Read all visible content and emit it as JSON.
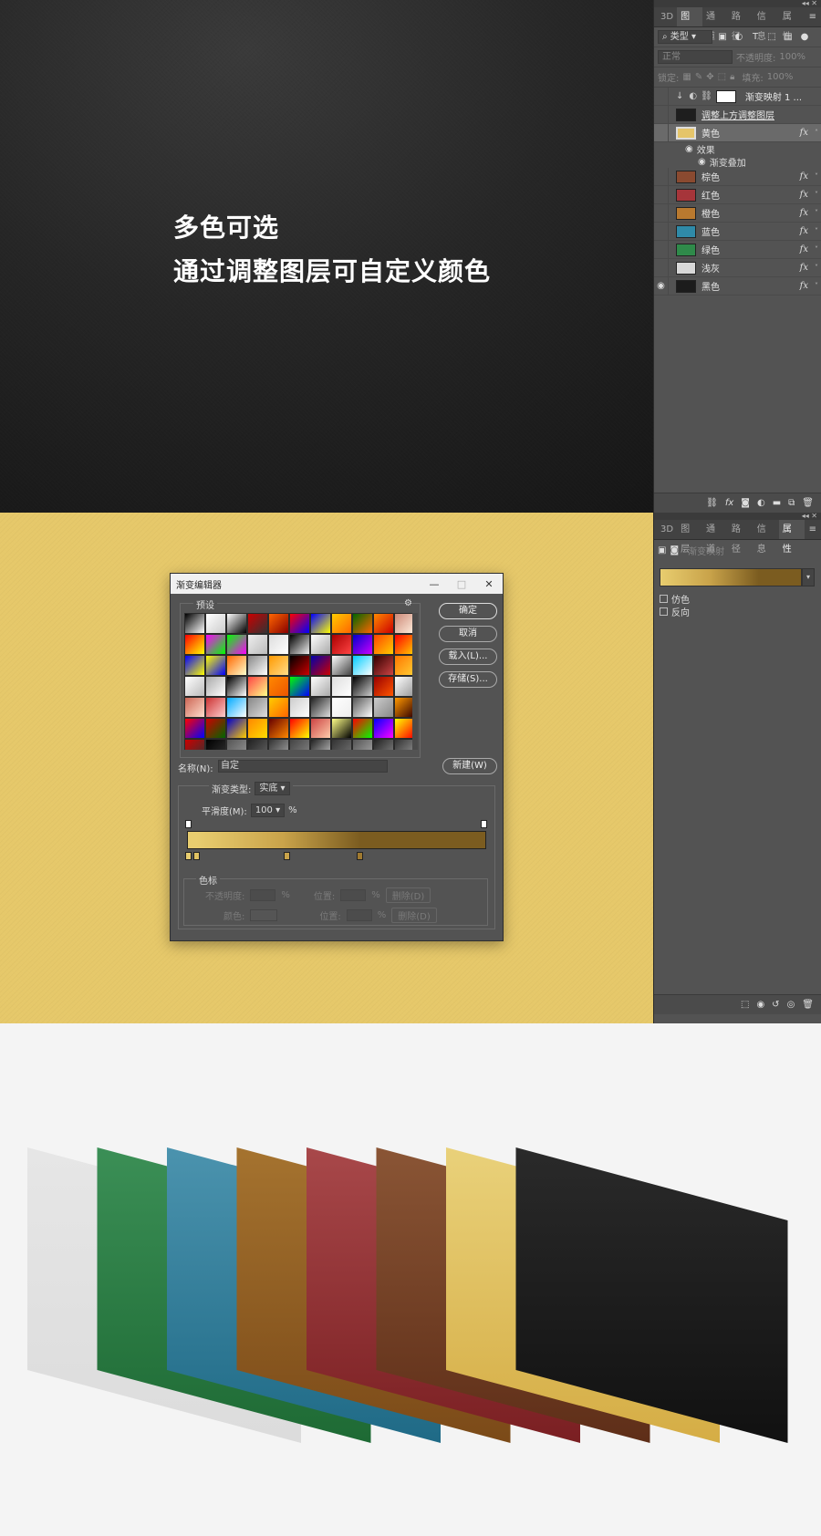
{
  "section1": {
    "headline_line1": "多色可选",
    "headline_line2": "通过调整图层可自定义颜色",
    "panel": {
      "tabs": [
        "3D",
        "图层",
        "通道",
        "路径",
        "信息",
        "属性"
      ],
      "active_tab": "图层",
      "filter_label": "类型",
      "blend_mode": "正常",
      "opacity_label": "不透明度:",
      "opacity_value": "100%",
      "lock_label": "锁定:",
      "fill_label": "填充:",
      "fill_value": "100%",
      "adjustment_layer": "渐变映射 1 ...",
      "adjust_above_layer": "调整上方调整图层",
      "selected_layer": "黄色",
      "effects_label": "效果",
      "gradient_overlay_label": "渐变叠加",
      "layers": [
        {
          "name": "棕色",
          "color": "#8a4a30",
          "fx": "fx"
        },
        {
          "name": "红色",
          "color": "#a6353a",
          "fx": "fx"
        },
        {
          "name": "橙色",
          "color": "#b9792f",
          "fx": "fx"
        },
        {
          "name": "蓝色",
          "color": "#2f8aa8",
          "fx": "fx"
        },
        {
          "name": "绿色",
          "color": "#2f8a4a",
          "fx": "fx"
        },
        {
          "name": "浅灰",
          "color": "#d8d8d8",
          "fx": "fx"
        },
        {
          "name": "黑色",
          "color": "#1c1c1c",
          "fx": "fx"
        }
      ],
      "selected_fx": "fx"
    }
  },
  "section2": {
    "dialog": {
      "title": "渐变编辑器",
      "presets_label": "预设",
      "ok": "确定",
      "cancel": "取消",
      "load": "载入(L)...",
      "save": "存储(S)...",
      "name_label": "名称(N):",
      "name_value": "自定",
      "new_button": "新建(W)",
      "gradient_type_label": "渐变类型:",
      "gradient_type_value": "实底",
      "smoothness_label": "平滑度(M):",
      "smoothness_value": "100",
      "percent": "%",
      "color_stops_label": "色标",
      "opacity_label": "不透明度:",
      "color_label": "颜色:",
      "position_label": "位置:",
      "delete_label": "删除(D)"
    },
    "panel": {
      "tabs": [
        "3D",
        "图层",
        "通道",
        "路径",
        "信息",
        "属性"
      ],
      "active_tab": "属性",
      "properties_title": "渐变映射",
      "dither": "仿色",
      "reverse": "反向"
    },
    "colors": {
      "bg": "#e6c86a",
      "grad_start": "#e8cd6f",
      "grad_end": "#7b5c20"
    }
  },
  "section3": {
    "cards": [
      {
        "name": "light-gray",
        "top": "#e6e6e6",
        "bottom": "#dcdcdc"
      },
      {
        "name": "green",
        "top": "#3b8f56",
        "bottom": "#1e6a34"
      },
      {
        "name": "blue",
        "top": "#4b93ae",
        "bottom": "#1f6a86"
      },
      {
        "name": "orange",
        "top": "#a5732f",
        "bottom": "#7b4a18"
      },
      {
        "name": "red",
        "top": "#a8484a",
        "bottom": "#7a1f22"
      },
      {
        "name": "brown",
        "top": "#8a5535",
        "bottom": "#5e2e18"
      },
      {
        "name": "yellow",
        "top": "#e9d17a",
        "bottom": "#d5ad45"
      },
      {
        "name": "black",
        "top": "#2a2a2a",
        "bottom": "#111111"
      }
    ]
  }
}
